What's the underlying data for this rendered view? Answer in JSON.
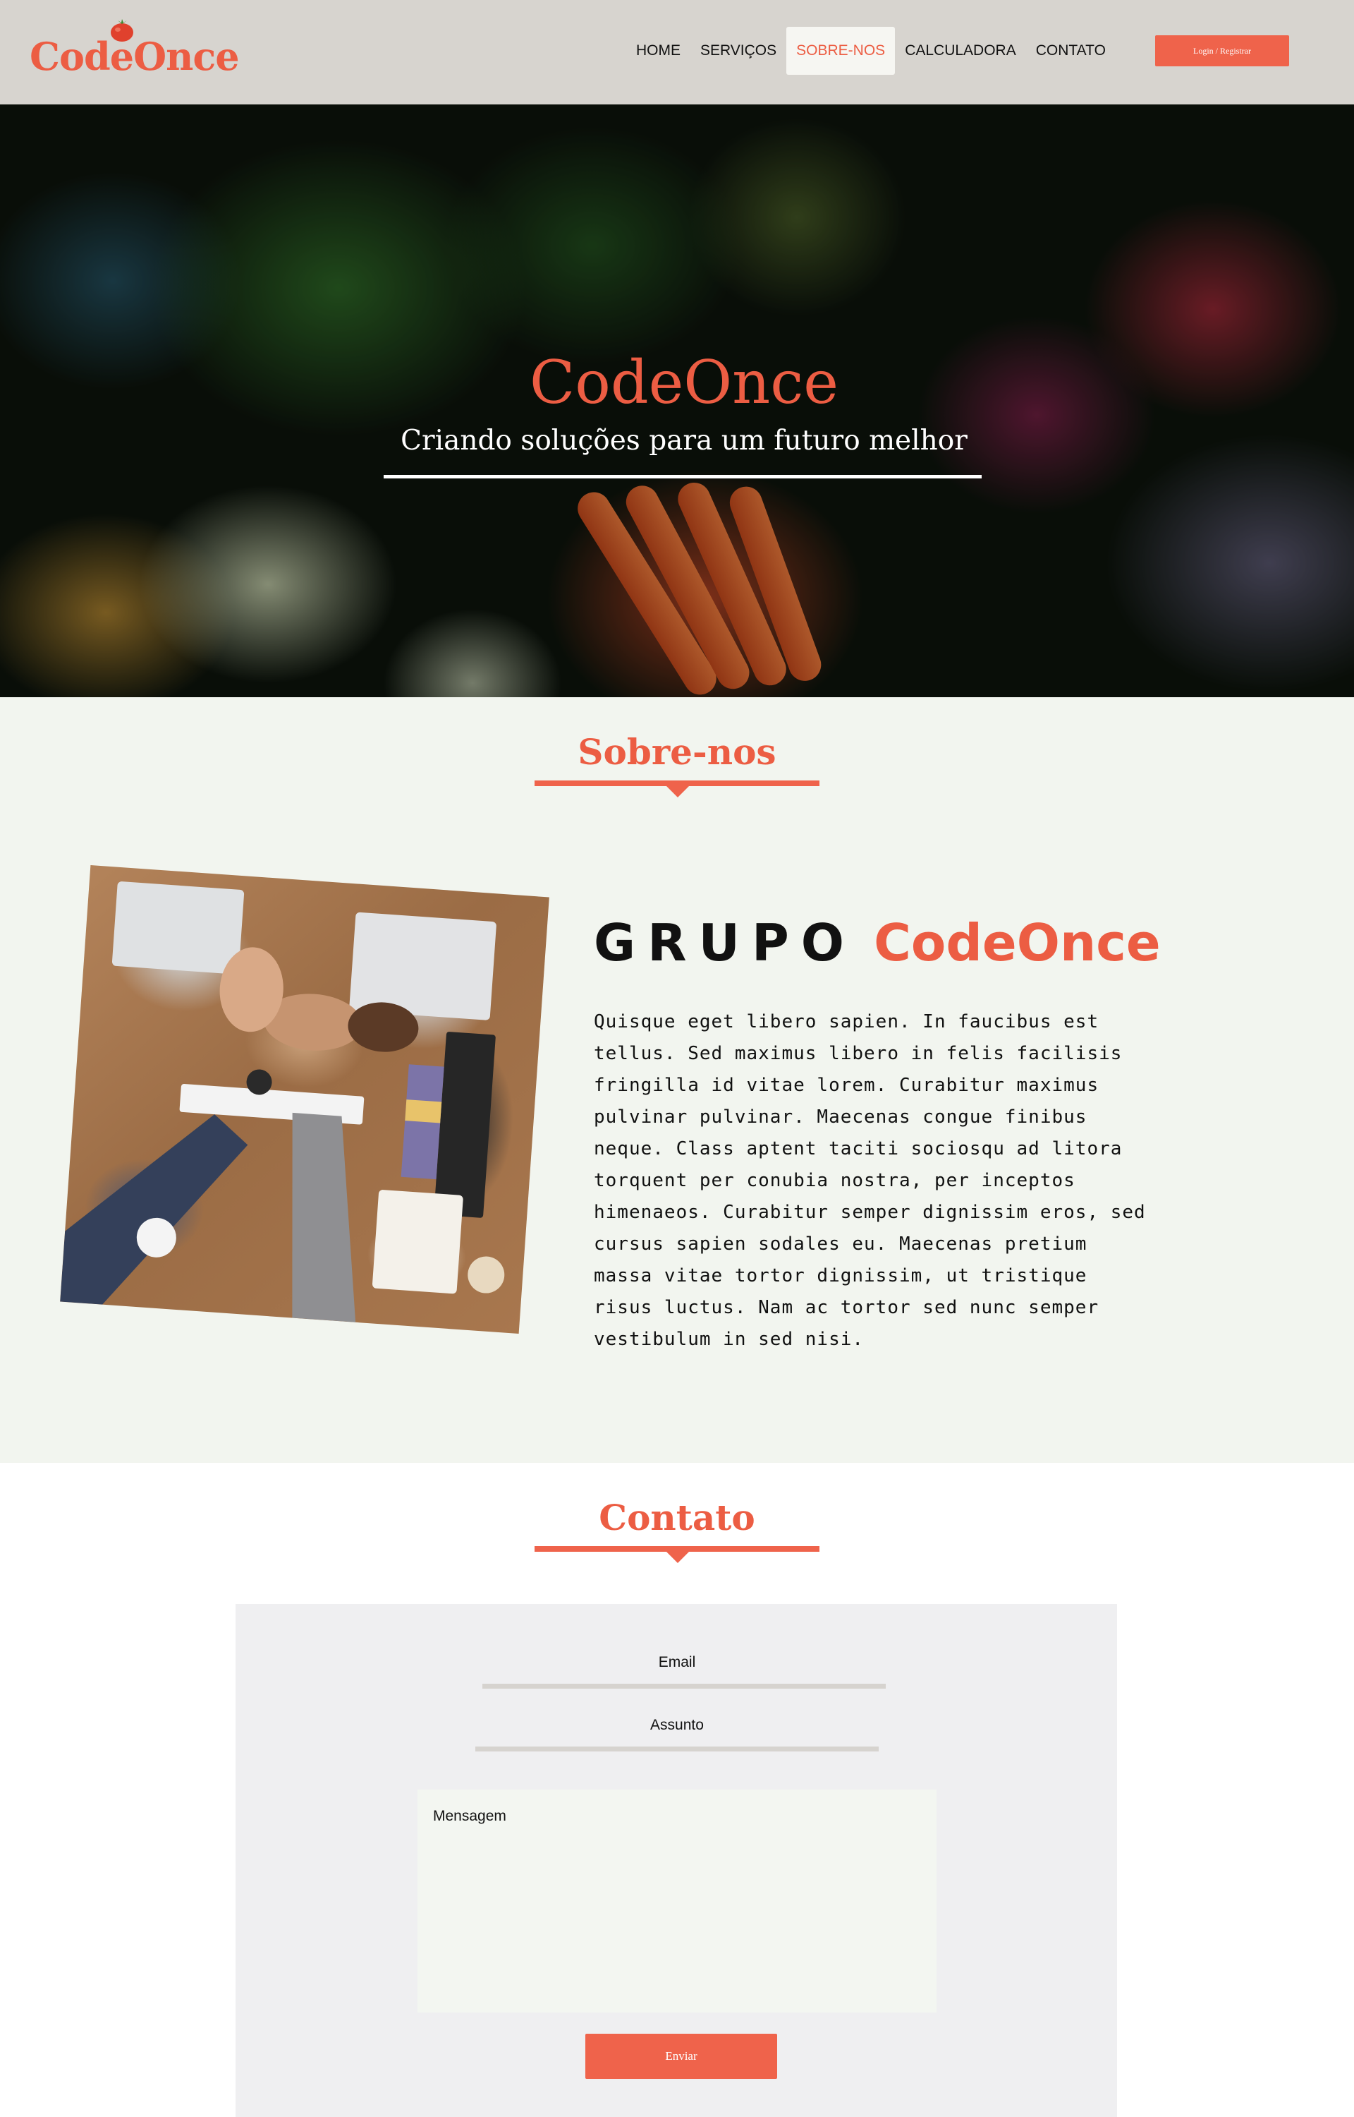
{
  "header": {
    "logo_text": "CodeOnce",
    "nav": [
      {
        "label": "HOME"
      },
      {
        "label": "SERVIÇOS"
      },
      {
        "label": "SOBRE-NOS",
        "active": true
      },
      {
        "label": "CALCULADORA"
      },
      {
        "label": "CONTATO"
      }
    ],
    "login_label": "Login / Registrar",
    "icons": {
      "logo": "tomato-icon"
    }
  },
  "hero": {
    "title": "CodeOnce",
    "subtitle": "Criando soluções para um futuro melhor"
  },
  "about": {
    "section_title": "Sobre-nos",
    "heading_word": "GRUPO",
    "heading_brand": "CodeOnce",
    "paragraph": "Quisque eget libero sapien. In faucibus est tellus. Sed maximus libero in felis facilisis fringilla id vitae lorem. Curabitur maximus pulvinar pulvinar. Maecenas congue finibus neque. Class aptent taciti sociosqu ad litora torquent per conubia nostra, per inceptos himenaeos. Curabitur semper dignissim eros, sed cursus sapien sodales eu. Maecenas pretium massa vitae tortor dignissim, ut tristique risus luctus. Nam ac tortor sed nunc semper vestibulum in sed nisi."
  },
  "contact": {
    "section_title": "Contato",
    "email_label": "Email",
    "subject_label": "Assunto",
    "message_placeholder": "Mensagem",
    "send_label": "Enviar"
  },
  "colors": {
    "accent": "#ec5d43",
    "header_bg": "#d7d4cf",
    "about_bg": "#f2f5ef",
    "form_bg": "#efeff1"
  }
}
